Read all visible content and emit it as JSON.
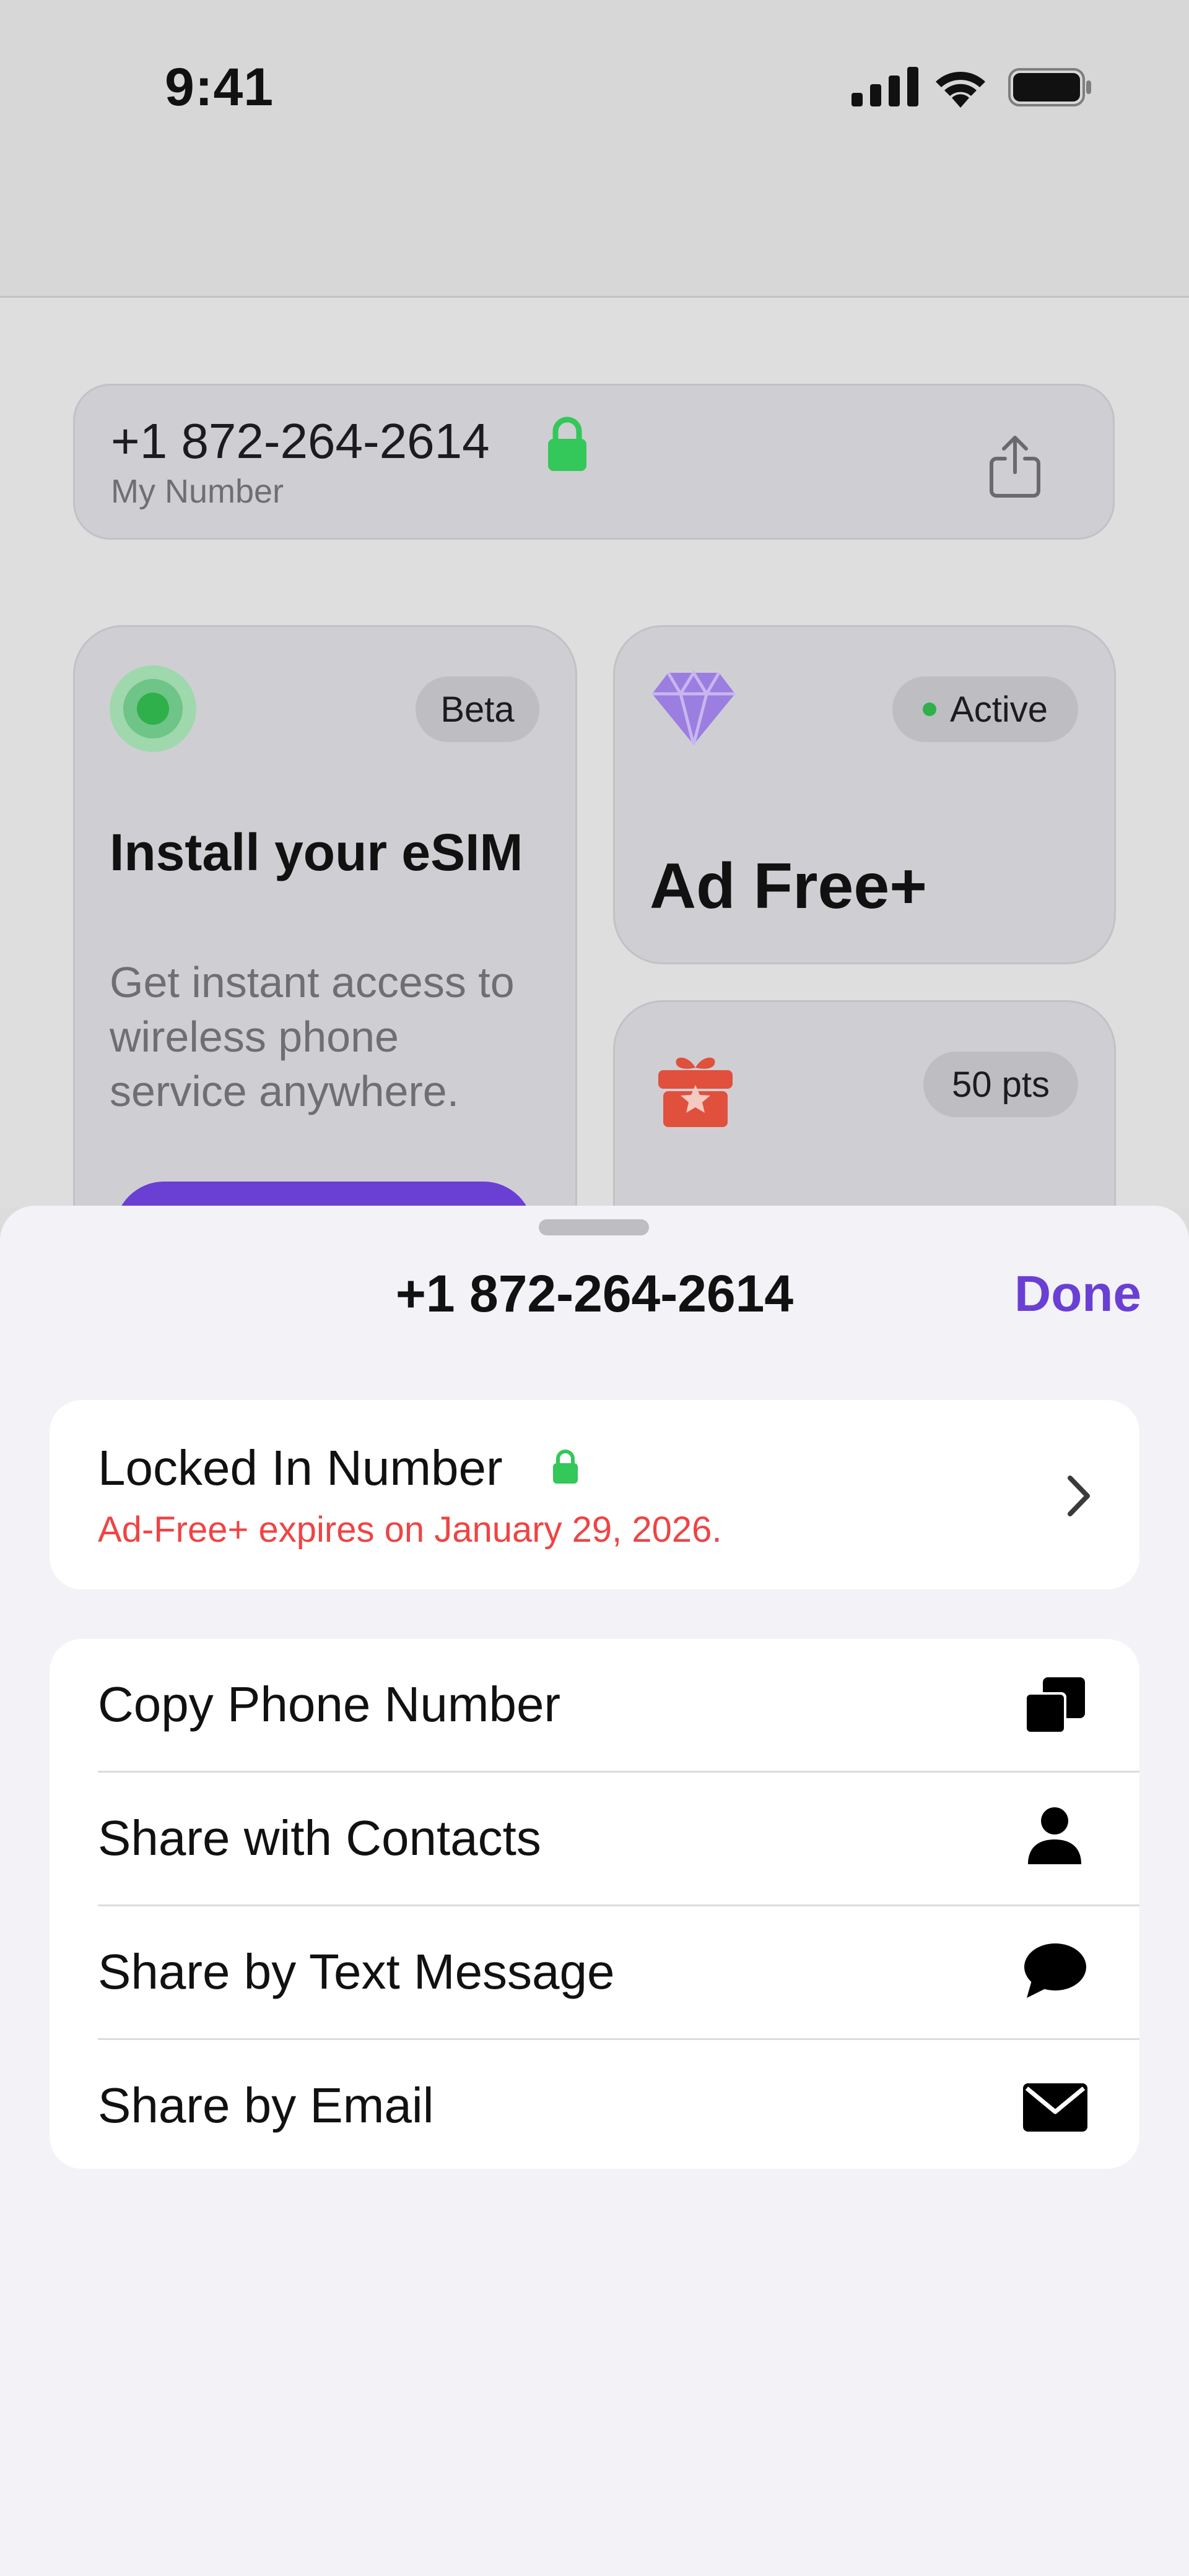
{
  "status_bar": {
    "time": "9:41"
  },
  "background": {
    "number_card": {
      "number": "+1 872-264-2614",
      "label": "My Number"
    },
    "esim_tile": {
      "badge": "Beta",
      "title": "Install your eSIM",
      "description": " Get instant access to wireless phone service anywhere."
    },
    "adfree_tile": {
      "badge": "Active",
      "title": "Ad Free+"
    },
    "points_tile": {
      "badge": "50 pts"
    }
  },
  "sheet": {
    "title": "+1 872-264-2614",
    "done_label": "Done",
    "locked": {
      "title": "Locked In Number",
      "subtitle": "Ad-Free+ expires on January 29, 2026."
    },
    "actions": [
      {
        "label": "Copy Phone Number",
        "icon": "copy-icon"
      },
      {
        "label": "Share with Contacts",
        "icon": "person-icon"
      },
      {
        "label": "Share by Text Message",
        "icon": "message-bubble-icon"
      },
      {
        "label": "Share by Email",
        "icon": "envelope-icon"
      }
    ]
  },
  "colors": {
    "accent": "#6a3fd4",
    "lock_green": "#34c759",
    "warning_red": "#ef4444",
    "gift_red": "#e0503d",
    "diamond_purple": "#9b7ee0"
  }
}
